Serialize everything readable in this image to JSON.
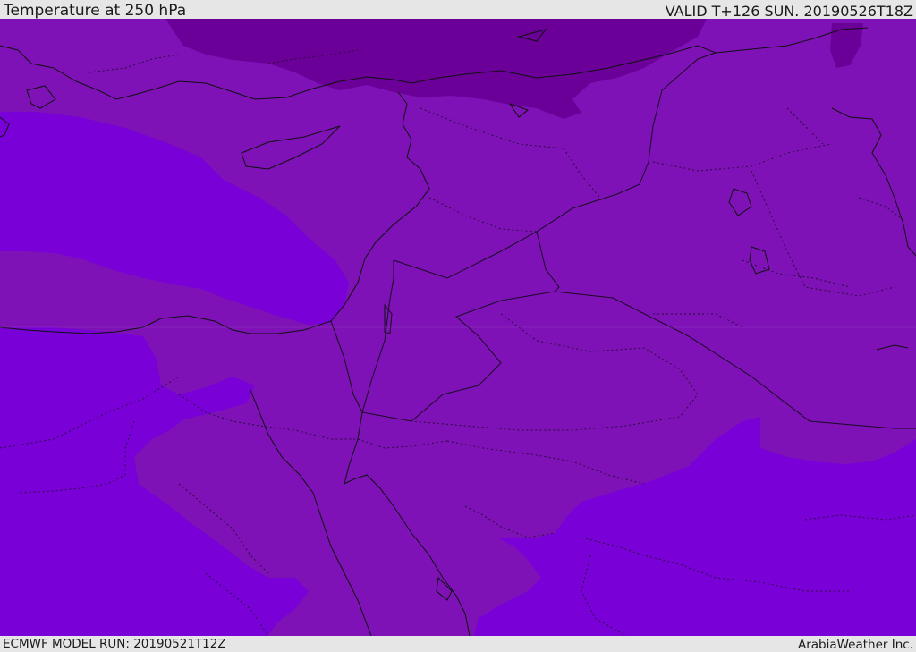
{
  "header": {
    "title": "Temperature at 250 hPa",
    "valid": "VALID T+126 SUN. 20190526T18Z"
  },
  "footer": {
    "model_run": "ECMWF MODEL RUN: 20190521T12Z",
    "credit": "ArabiaWeather Inc."
  },
  "colors": {
    "warm_band": "#7e12b6",
    "mid_band": "#7a00d8",
    "cold_band": "#6a0098",
    "coastline": "#101010",
    "border": "#2a0a3a"
  }
}
